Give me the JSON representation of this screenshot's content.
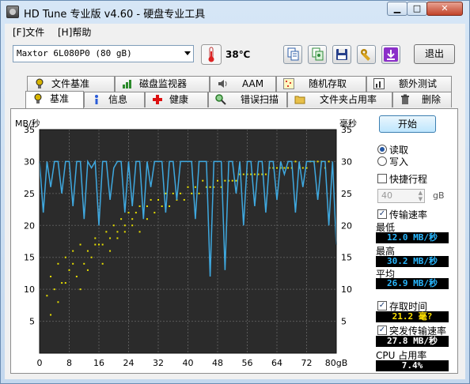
{
  "window": {
    "title": "HD Tune 专业版 v4.60 - 硬盘专业工具"
  },
  "menu": [
    {
      "label": "[F]文件"
    },
    {
      "label": "[H]帮助"
    }
  ],
  "toolbar": {
    "drive": "Maxtor 6L080P0 (80 gB)",
    "temperature": "38℃",
    "exit_label": "退出"
  },
  "tabs_top": [
    {
      "label": "文件基准",
      "icon": "file-benchmark-icon"
    },
    {
      "label": "磁盘监视器",
      "icon": "disk-monitor-icon"
    },
    {
      "label": "AAM",
      "icon": "speaker-icon"
    },
    {
      "label": "随机存取",
      "icon": "random-access-icon"
    },
    {
      "label": "额外测试",
      "icon": "extra-tests-icon"
    }
  ],
  "tabs_bottom": [
    {
      "label": "基准",
      "icon": "benchmark-icon",
      "active": true
    },
    {
      "label": "信息",
      "icon": "info-icon"
    },
    {
      "label": "健康",
      "icon": "health-icon"
    },
    {
      "label": "错误扫描",
      "icon": "magnifier-icon"
    },
    {
      "label": "文件夹占用率",
      "icon": "folder-icon"
    },
    {
      "label": "删除",
      "icon": "trash-icon"
    }
  ],
  "controls": {
    "start_label": "开始",
    "read_label": "读取",
    "write_label": "写入",
    "short_stroke_label": "快捷行程",
    "short_stroke_value": "40",
    "short_stroke_unit": "gB",
    "transfer_rate_label": "传输速率",
    "min_label": "最低",
    "min_value": "12.0 MB/秒",
    "max_label": "最高",
    "max_value": "30.2 MB/秒",
    "avg_label": "平均",
    "avg_value": "26.9 MB/秒",
    "access_time_label": "存取时间",
    "access_time_value": "21.2 毫?",
    "burst_label": "突发传输速率",
    "burst_value": "27.8 MB/秒",
    "cpu_label": "CPU 占用率",
    "cpu_value": "7.4%"
  },
  "colors": {
    "line": "#3fa9e0",
    "points": "#e8e000",
    "grid": "#5a5a5a",
    "plot_bg": "#2b2b2b"
  },
  "chart_data": {
    "type": "line",
    "ylabel_left": "MB/秒",
    "ylabel_right": "毫秒",
    "x_unit": "gB",
    "xlim": [
      0,
      80
    ],
    "ylim": [
      0,
      35
    ],
    "x_ticks": [
      0,
      8,
      16,
      24,
      32,
      40,
      48,
      56,
      64,
      72,
      80
    ],
    "y_ticks": [
      5,
      10,
      15,
      20,
      25,
      30,
      35
    ],
    "series": [
      {
        "kind": "transfer-rate",
        "x": [
          0,
          1,
          2,
          3,
          4,
          5,
          6,
          7,
          8,
          9,
          10,
          11,
          12,
          13,
          14,
          15,
          16,
          17,
          18,
          19,
          20,
          21,
          22,
          23,
          24,
          25,
          26,
          27,
          28,
          29,
          30,
          31,
          32,
          33,
          34,
          35,
          36,
          37,
          38,
          39,
          40,
          41,
          42,
          43,
          44,
          45,
          46,
          47,
          48,
          49,
          50,
          51,
          52,
          53,
          54,
          55,
          56,
          57,
          58,
          59,
          60,
          61,
          62,
          63,
          64,
          65,
          66,
          67,
          68,
          69,
          70,
          71,
          72,
          73,
          74,
          75,
          76,
          77,
          78,
          79,
          80
        ],
        "y": [
          30,
          22,
          30,
          26,
          30,
          30,
          25,
          30,
          30,
          23,
          30,
          30,
          21,
          30,
          29,
          30,
          20,
          30,
          30,
          24,
          29,
          30,
          30,
          22,
          30,
          23,
          30,
          30,
          21,
          30,
          26,
          30,
          30,
          30,
          22,
          30,
          30,
          24,
          30,
          30,
          30,
          30,
          21,
          30,
          30,
          30,
          12,
          30,
          30,
          30,
          13,
          30,
          30,
          25,
          30,
          20,
          30,
          30,
          23,
          30,
          30,
          22,
          30,
          30,
          24,
          30,
          28,
          30,
          30,
          22,
          30,
          26,
          30,
          30,
          30,
          24,
          30,
          30,
          20,
          30,
          17
        ]
      },
      {
        "kind": "access-time",
        "x": [
          2,
          3,
          4,
          5,
          6,
          7,
          8,
          9,
          10,
          11,
          12,
          13,
          14,
          15,
          16,
          17,
          18,
          19,
          20,
          21,
          22,
          23,
          24,
          25,
          26,
          27,
          28,
          29,
          30,
          32,
          34,
          36,
          38,
          40,
          42,
          44,
          46,
          48,
          50,
          52,
          54,
          56,
          58,
          60,
          62,
          64,
          66,
          68,
          70,
          72,
          74,
          76,
          78,
          3,
          5,
          7,
          9,
          11,
          13,
          15,
          17,
          19,
          21,
          23,
          25,
          27,
          29,
          31,
          33,
          35,
          37,
          39,
          41,
          43,
          45,
          47,
          49,
          51,
          53,
          55,
          57,
          59,
          61,
          63,
          65,
          67,
          69,
          71,
          73,
          75,
          77
        ],
        "y": [
          9,
          12,
          10,
          14,
          11,
          15,
          13,
          16,
          12,
          17,
          14,
          16,
          15,
          18,
          17,
          17,
          19,
          18,
          20,
          19,
          21,
          20,
          22,
          21,
          22,
          23,
          22,
          23,
          24,
          24,
          25,
          25,
          25,
          26,
          26,
          27,
          26,
          27,
          27,
          27,
          28,
          28,
          28,
          28,
          29,
          29,
          29,
          29,
          29,
          29,
          30,
          30,
          30,
          6,
          8,
          11,
          14,
          10,
          13,
          17,
          14,
          16,
          18,
          19,
          20,
          19,
          21,
          22,
          23,
          23,
          24,
          24,
          25,
          25,
          26,
          26,
          26,
          27,
          27,
          28,
          28,
          28,
          28,
          29,
          29,
          29,
          30,
          29,
          30,
          30,
          29
        ]
      }
    ]
  }
}
